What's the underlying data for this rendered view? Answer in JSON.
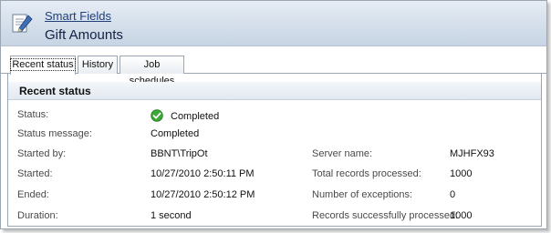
{
  "header": {
    "breadcrumb": "Smart Fields",
    "title": "Gift Amounts",
    "icon": "document-pencil-icon"
  },
  "tabs": [
    {
      "label": "Recent status",
      "active": true
    },
    {
      "label": "History",
      "active": false
    },
    {
      "label": "Job schedules",
      "active": false
    }
  ],
  "section": {
    "title": "Recent status"
  },
  "fields": {
    "status_label": "Status:",
    "status_value": "Completed",
    "status_icon": "check-circle-icon",
    "status_message_label": "Status message:",
    "status_message_value": "Completed",
    "started_by_label": "Started by:",
    "started_by_value": "BBNT\\TripOt",
    "started_label": "Started:",
    "started_value": "10/27/2010 2:50:11 PM",
    "ended_label": "Ended:",
    "ended_value": "10/27/2010 2:50:12 PM",
    "duration_label": "Duration:",
    "duration_value": "1 second",
    "server_name_label": "Server name:",
    "server_name_value": "MJHFX93",
    "total_records_label": "Total records processed:",
    "total_records_value": "1000",
    "exceptions_label": "Number of exceptions:",
    "exceptions_value": "0",
    "success_label": "Records successfully processed:",
    "success_value": "1000"
  },
  "colors": {
    "header_gradient_top": "#e6ecf4",
    "header_gradient_bottom": "#c7d4e3",
    "link": "#1f3f7a",
    "success": "#3aa935"
  }
}
